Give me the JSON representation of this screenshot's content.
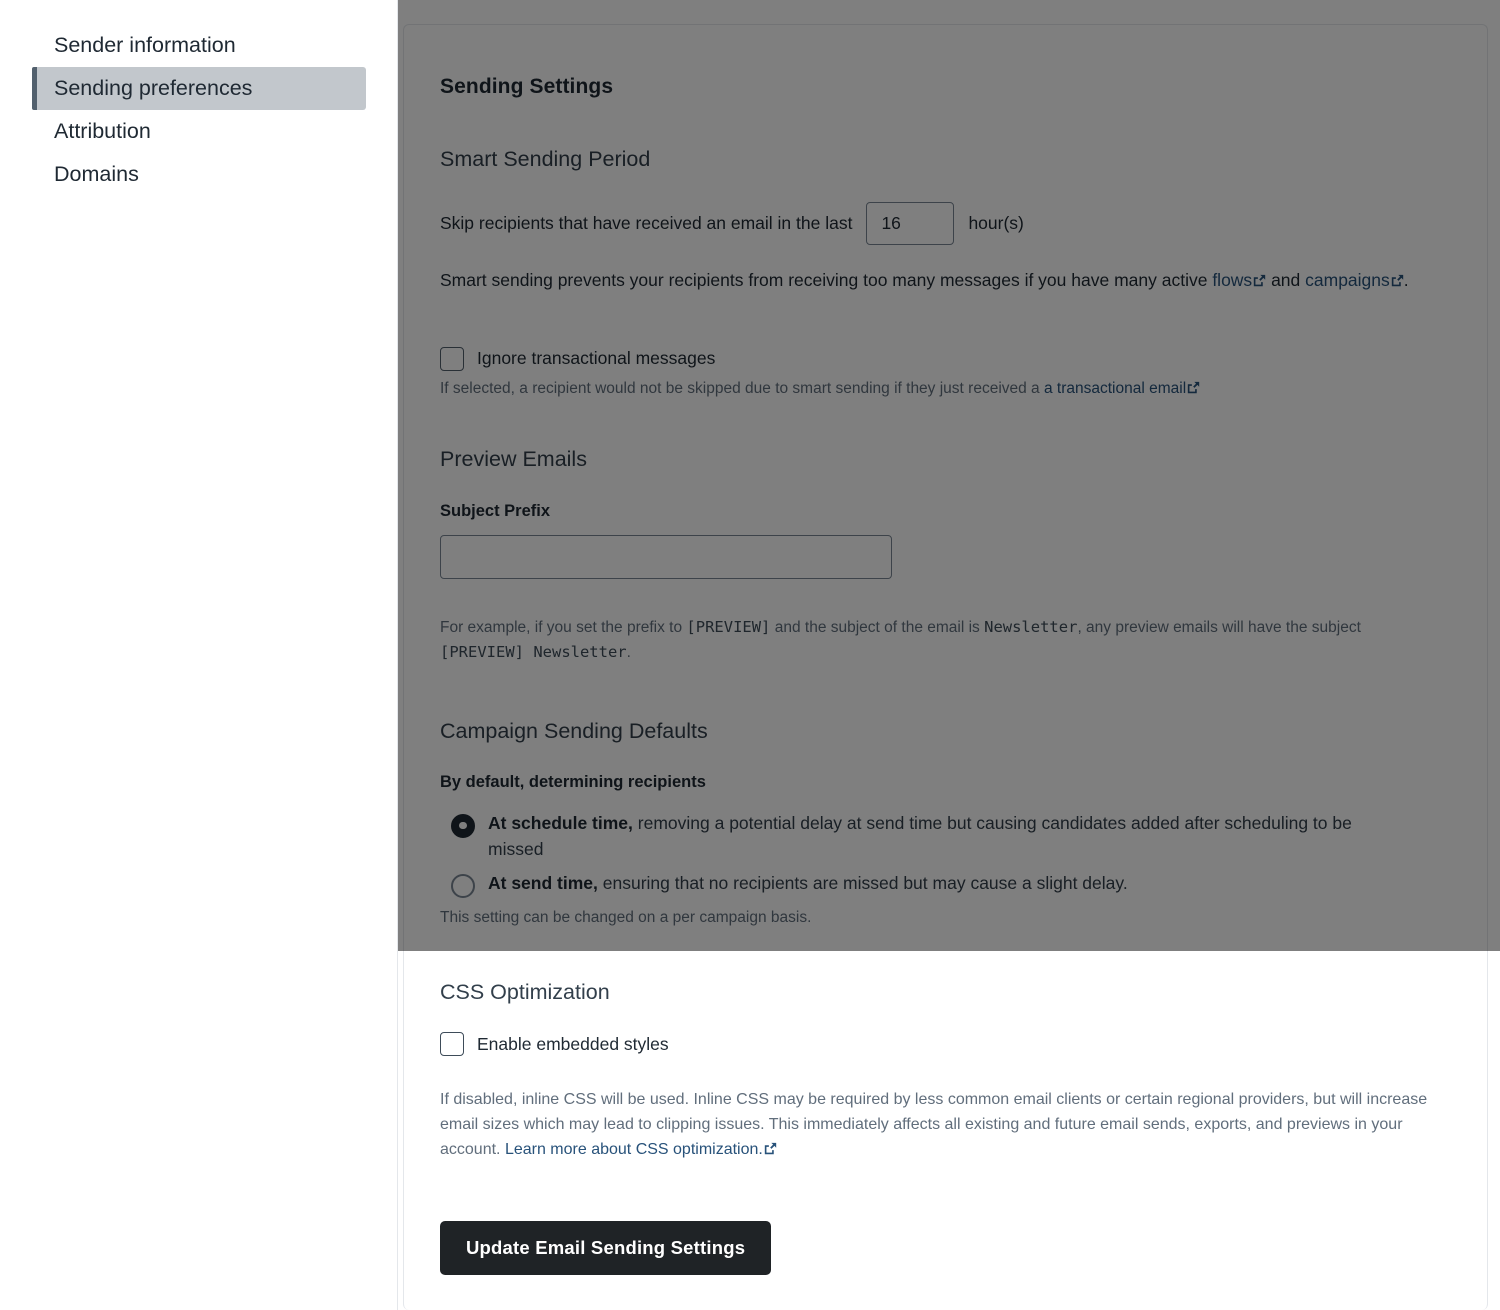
{
  "sidebar": {
    "items": [
      {
        "label": "Sender information",
        "active": false
      },
      {
        "label": "Sending preferences",
        "active": true
      },
      {
        "label": "Attribution",
        "active": false
      },
      {
        "label": "Domains",
        "active": false
      }
    ]
  },
  "main": {
    "title": "Sending Settings",
    "smart_sending": {
      "heading": "Smart Sending Period",
      "skip_prefix": "Skip recipients that have received an email in the last",
      "hours_value": "16",
      "hours_suffix": "hour(s)",
      "desc_part1": "Smart sending prevents your recipients from receiving too many messages if you have many active",
      "link_flows": "flows",
      "desc_part2": "and",
      "link_campaigns": "campaigns",
      "desc_part3": ".",
      "checkbox_label": "Ignore transactional messages",
      "checkbox_checked": false,
      "checkbox_help_prefix": "If selected, a recipient would not be skipped due to smart sending if they just received a",
      "checkbox_help_link": "a transactional email"
    },
    "preview_emails": {
      "heading": "Preview Emails",
      "subject_prefix_label": "Subject Prefix",
      "subject_prefix_value": "",
      "subject_prefix_placeholder": "",
      "example_part1": "For example, if you set the prefix to",
      "example_code1": "[PREVIEW]",
      "example_part2": "and the subject of the email is",
      "example_code2": "Newsletter",
      "example_part3": ", any preview emails will have the subject",
      "example_code3": "[PREVIEW] Newsletter",
      "example_part4": "."
    },
    "campaign_defaults": {
      "heading": "Campaign Sending Defaults",
      "subheading": "By default, determining recipients",
      "options": [
        {
          "bold": "At schedule time,",
          "rest": " removing a potential delay at send time but causing candidates added after scheduling to be missed",
          "selected": true
        },
        {
          "bold": "At send time,",
          "rest": " ensuring that no recipients are missed but may cause a slight delay.",
          "selected": false
        }
      ],
      "footnote": "This setting can be changed on a per campaign basis."
    },
    "css_optimization": {
      "heading": "CSS Optimization",
      "checkbox_label": "Enable embedded styles",
      "checkbox_checked": false,
      "help_text": "If disabled, inline CSS will be used. Inline CSS may be required by less common email clients or certain regional providers, but will increase email sizes which may lead to clipping issues. This immediately affects all existing and future email sends, exports, and previews in your account.",
      "help_link": "Learn more about CSS optimization."
    },
    "submit_label": "Update Email Sending Settings"
  },
  "colors": {
    "link": "#28527a",
    "active_nav_bg": "#c2c7cc",
    "active_nav_bar": "#52606d",
    "button_bg": "#1f2326",
    "scrim": "rgba(0,0,0,0.5)"
  }
}
